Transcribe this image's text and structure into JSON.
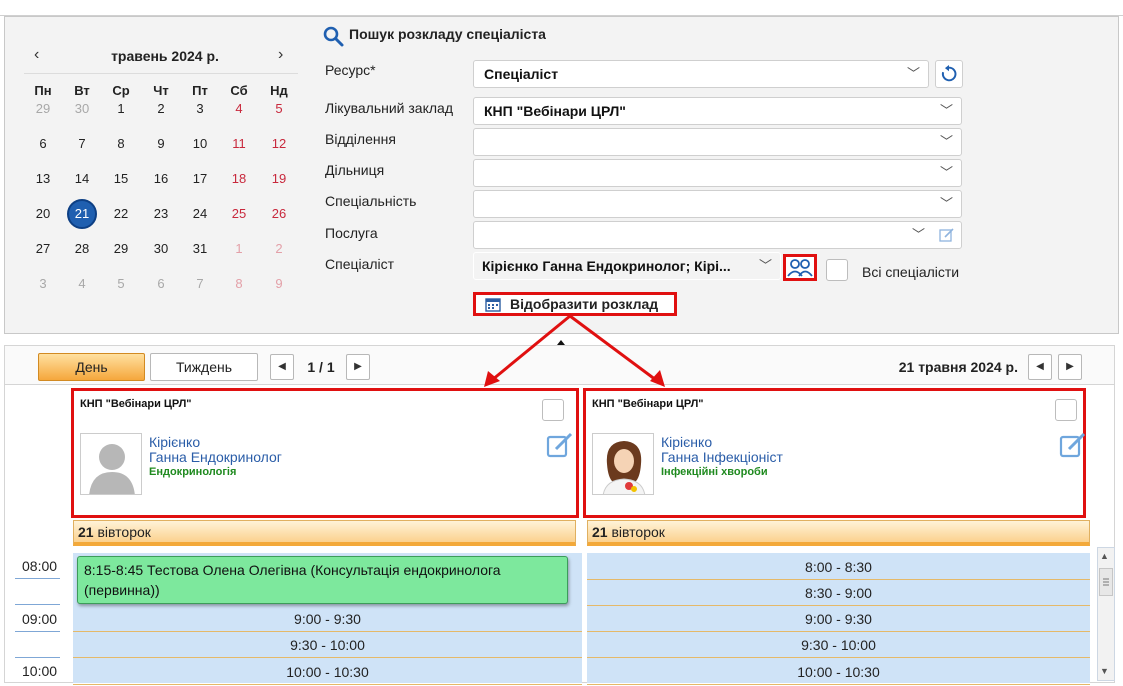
{
  "calendar": {
    "prev": "‹",
    "next": "›",
    "title": "травень 2024 р.",
    "weekdays": [
      "Пн",
      "Вт",
      "Ср",
      "Чт",
      "Пт",
      "Сб",
      "Нд"
    ],
    "weeks": [
      [
        "29",
        "30",
        "1",
        "2",
        "3",
        "4",
        "5"
      ],
      [
        "6",
        "7",
        "8",
        "9",
        "10",
        "11",
        "12"
      ],
      [
        "13",
        "14",
        "15",
        "16",
        "17",
        "18",
        "19"
      ],
      [
        "20",
        "21",
        "22",
        "23",
        "24",
        "25",
        "26"
      ],
      [
        "27",
        "28",
        "29",
        "30",
        "31",
        "1",
        "2"
      ],
      [
        "3",
        "4",
        "5",
        "6",
        "7",
        "8",
        "9"
      ]
    ],
    "selected": "21"
  },
  "search": {
    "title": "Пошук розкладу спеціаліста",
    "resource_label": "Ресурс*",
    "resource_value": "Спеціаліст",
    "facility_label": "Лікувальний заклад",
    "facility_value": "КНП \"Вебінари ЦРЛ\"",
    "department_label": "Відділення",
    "department_value": "",
    "district_label": "Дільниця",
    "district_value": "",
    "specialty_label": "Спеціальність",
    "specialty_value": "",
    "service_label": "Послуга",
    "service_value": "",
    "specialist_label": "Спеціаліст",
    "specialist_value": "Кірієнко Ганна Ендокринолог; Кірі...",
    "all_specialists_label": "Всі спеціалісти",
    "show_button": "Відобразити розклад"
  },
  "toolbar": {
    "day": "День",
    "week": "Тиждень",
    "page": "1 / 1",
    "date": "21 травня 2024 р."
  },
  "columns": [
    {
      "institution": "КНП \"Вебінари ЦРЛ\"",
      "name_line1": "Кірієнко",
      "name_line2": "Ганна Ендокринолог",
      "specialty": "Ендокринологія",
      "day_num": "21",
      "day_name": "вівторок"
    },
    {
      "institution": "КНП \"Вебінари ЦРЛ\"",
      "name_line1": "Кірієнко",
      "name_line2": "Ганна Інфекціоніст",
      "specialty": "Інфекційні хвороби",
      "day_num": "21",
      "day_name": "вівторок"
    }
  ],
  "times": [
    "08:00",
    "09:00",
    "10:00"
  ],
  "appointment": "8:15-8:45 Тестова Олена Олегівна (Консультація ендокринолога (первинна))",
  "slots_col1": [
    "9:00 - 9:30",
    "9:30 - 10:00",
    "10:00 - 10:30"
  ],
  "slots_col2": [
    "8:00 - 8:30",
    "8:30 - 9:00",
    "9:00 - 9:30",
    "9:30 - 10:00",
    "10:00 - 10:30"
  ],
  "colors": {
    "highlight": "#e01010",
    "selected_day": "#1f5fb0",
    "slot_bg": "#cfe3f7",
    "appointment_bg": "#7de89d",
    "day_header": "#f3a93a"
  }
}
